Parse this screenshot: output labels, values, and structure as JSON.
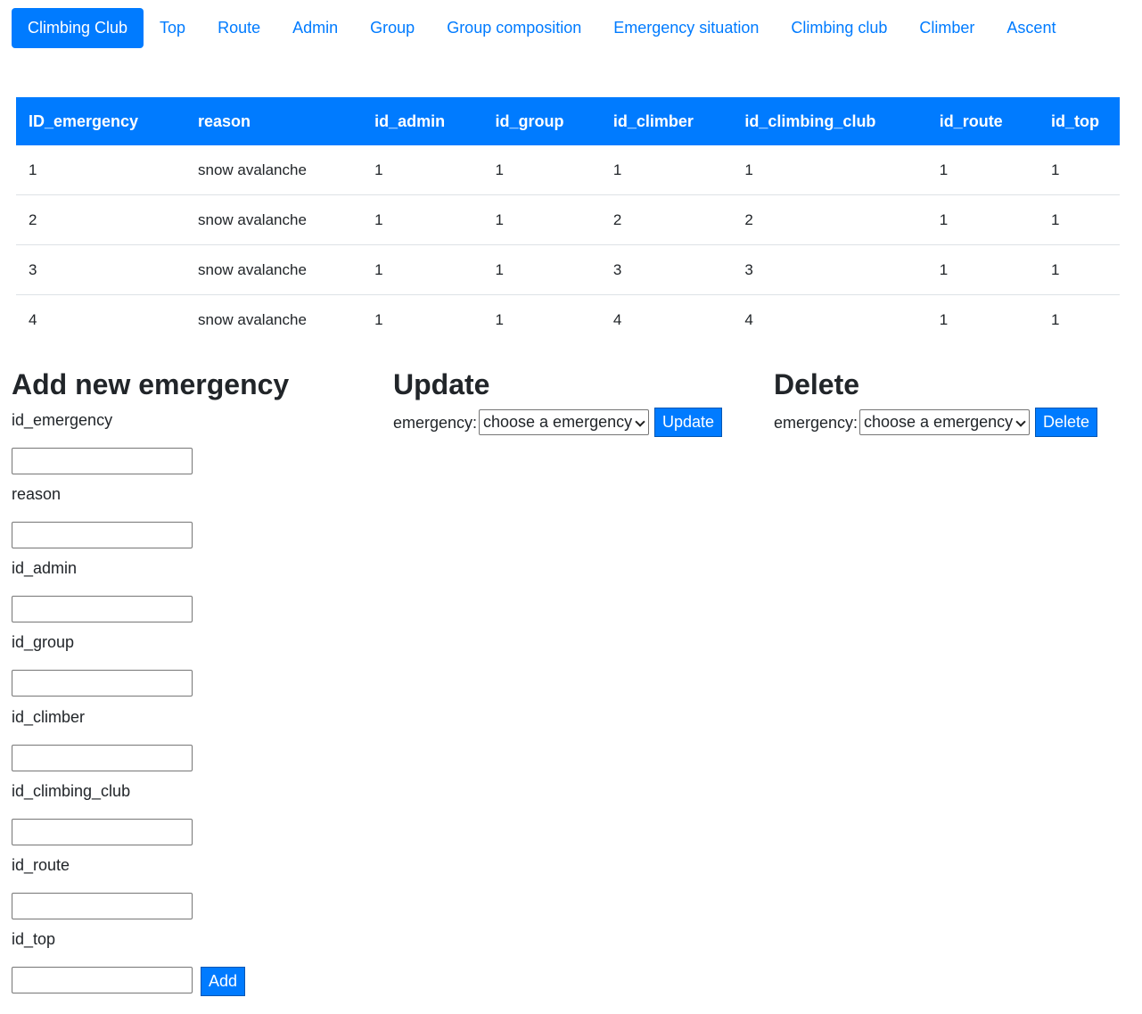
{
  "nav": {
    "items": [
      {
        "label": "Climbing Club",
        "active": true
      },
      {
        "label": "Top"
      },
      {
        "label": "Route"
      },
      {
        "label": "Admin"
      },
      {
        "label": "Group"
      },
      {
        "label": "Group composition"
      },
      {
        "label": "Emergency situation"
      },
      {
        "label": "Climbing club"
      },
      {
        "label": "Climber"
      },
      {
        "label": "Ascent"
      }
    ]
  },
  "table": {
    "headers": [
      "ID_emergency",
      "reason",
      "id_admin",
      "id_group",
      "id_climber",
      "id_climbing_club",
      "id_route",
      "id_top"
    ],
    "rows": [
      [
        "1",
        "snow avalanche",
        "1",
        "1",
        "1",
        "1",
        "1",
        "1"
      ],
      [
        "2",
        "snow avalanche",
        "1",
        "1",
        "2",
        "2",
        "1",
        "1"
      ],
      [
        "3",
        "snow avalanche",
        "1",
        "1",
        "3",
        "3",
        "1",
        "1"
      ],
      [
        "4",
        "snow avalanche",
        "1",
        "1",
        "4",
        "4",
        "1",
        "1"
      ]
    ]
  },
  "add_form": {
    "title": "Add new emergency",
    "fields": [
      "id_emergency",
      "reason",
      "id_admin",
      "id_group",
      "id_climber",
      "id_climbing_club",
      "id_route",
      "id_top"
    ],
    "submit_label": "Add"
  },
  "update_form": {
    "title": "Update",
    "select_label": "emergency:",
    "select_value": "choose a emergency",
    "button_label": "Update"
  },
  "delete_form": {
    "title": "Delete",
    "select_label": "emergency:",
    "select_value": "choose a emergency",
    "button_label": "Delete"
  },
  "colors": {
    "accent": "#007bff",
    "text": "#212529",
    "border": "#dee2e6"
  }
}
